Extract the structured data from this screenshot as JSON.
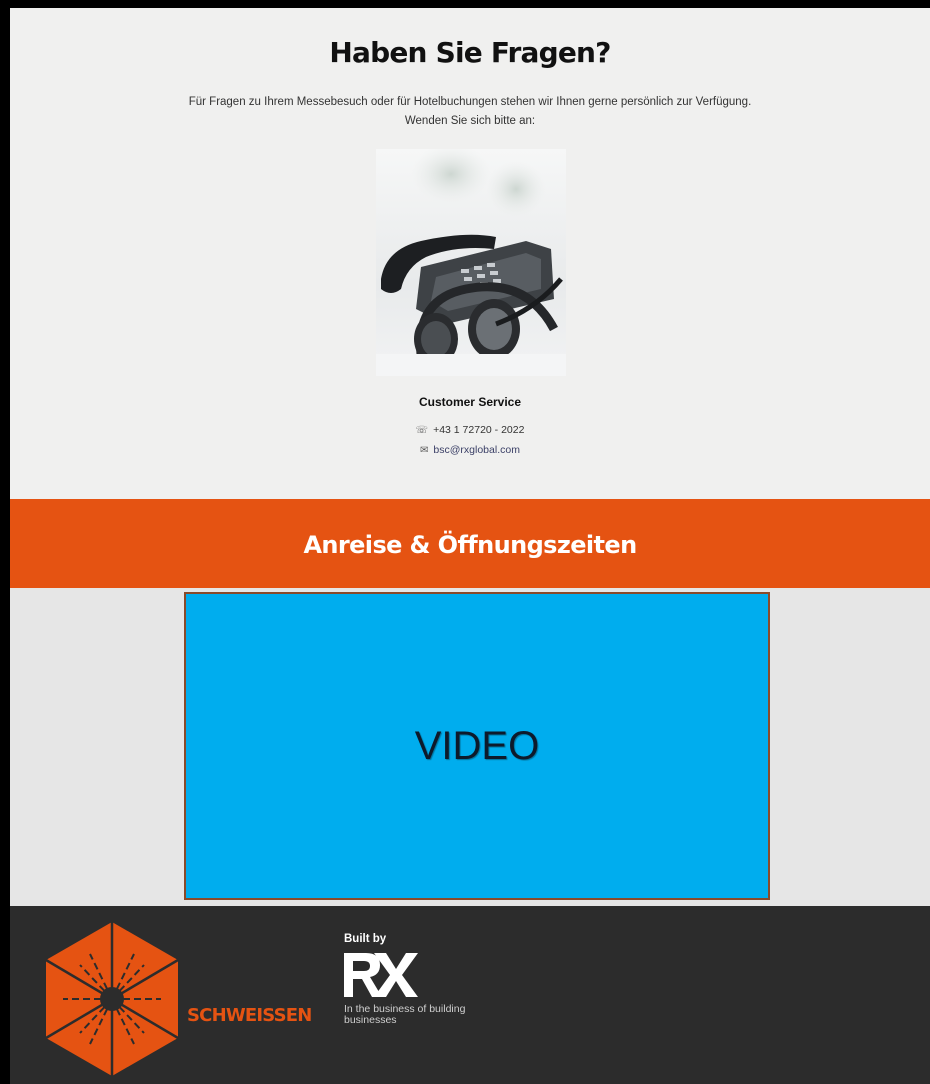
{
  "contact": {
    "title": "Haben Sie Fragen?",
    "intro_line1": "Für Fragen zu Ihrem Messebesuch oder für Hotelbuchungen stehen wir Ihnen gerne persönlich zur Verfügung.",
    "intro_line2": "Wenden Sie sich bitte an:",
    "service_title": "Customer Service",
    "phone": "+43 1 72720 - 2022",
    "email": "bsc@rxglobal.com",
    "phone_icon": "phone-icon",
    "email_icon": "envelope-icon"
  },
  "band": {
    "title": "Anreise & Öffnungszeiten",
    "color": "#e55312"
  },
  "video": {
    "label": "VIDEO",
    "background": "#00adee"
  },
  "footer": {
    "brand": "SCHWEISSEN",
    "built_by": "Built by",
    "company": "RX",
    "tagline": "In the business of building businesses",
    "background": "#2c2c2c"
  }
}
